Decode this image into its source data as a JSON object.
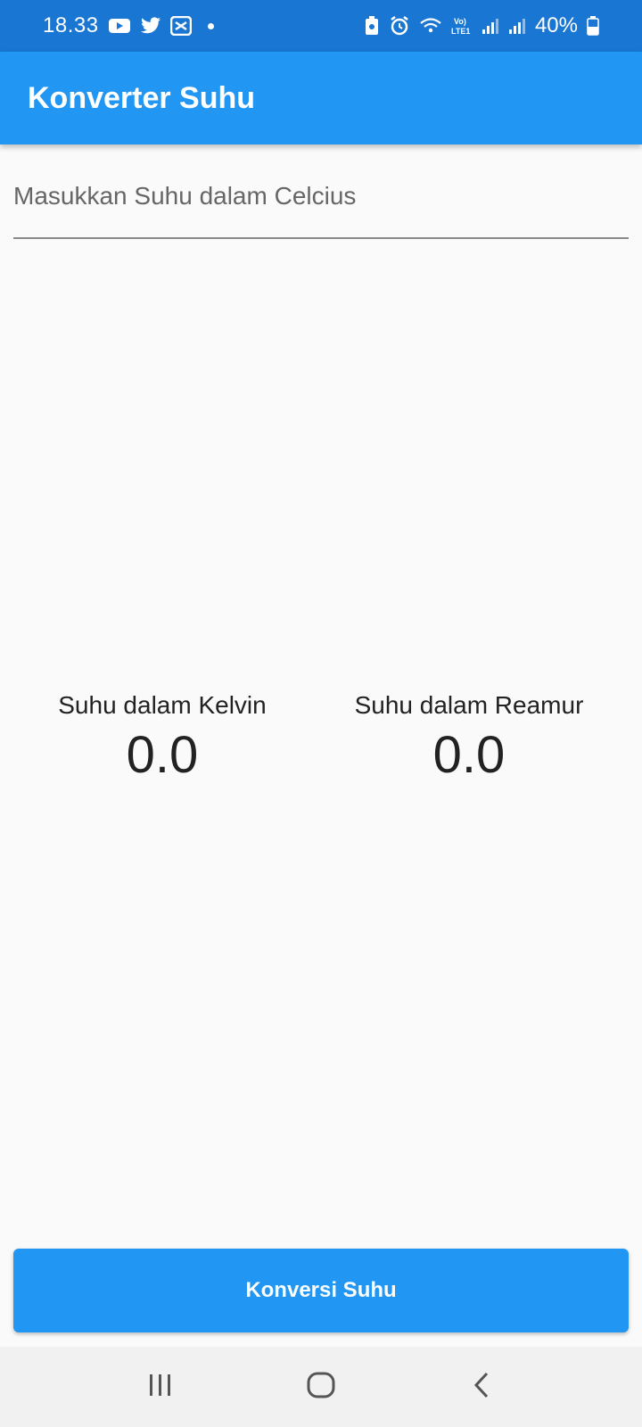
{
  "status_bar": {
    "time": "18.33",
    "battery_text": "40%",
    "icons_left": [
      "youtube-icon",
      "twitter-icon",
      "capcut-icon",
      "notification-dot"
    ],
    "icons_right": [
      "battery-saver-icon",
      "alarm-icon",
      "wifi-icon",
      "volte-lte-icon",
      "signal-icon",
      "signal-icon",
      "battery-icon"
    ]
  },
  "app_bar": {
    "title": "Konverter Suhu",
    "color": "#2196f3"
  },
  "input": {
    "placeholder": "Masukkan Suhu dalam Celcius",
    "value": ""
  },
  "results": {
    "kelvin": {
      "label": "Suhu dalam Kelvin",
      "value": "0.0"
    },
    "reamur": {
      "label": "Suhu dalam Reamur",
      "value": "0.0"
    }
  },
  "button": {
    "label": "Konversi Suhu"
  },
  "nav_bar": {
    "icons": [
      "recent-apps-icon",
      "home-icon",
      "back-icon"
    ]
  }
}
